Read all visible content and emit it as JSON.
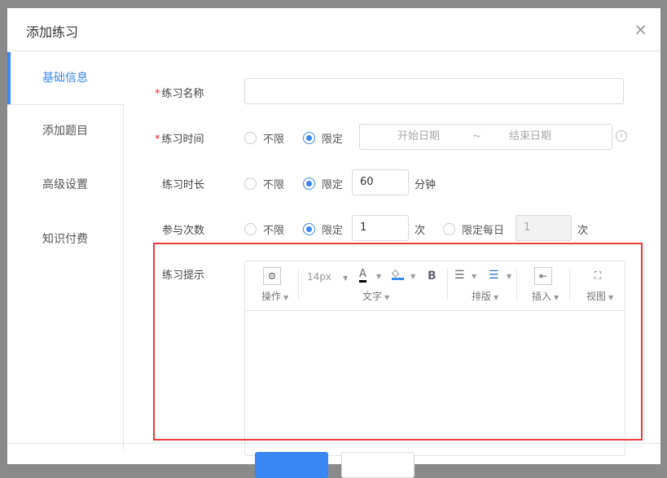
{
  "dialog": {
    "title": "添加练习",
    "close_icon": "×"
  },
  "sidebar": {
    "items": [
      {
        "label": "基础信息"
      },
      {
        "label": "添加题目"
      },
      {
        "label": "高级设置"
      },
      {
        "label": "知识付费"
      }
    ]
  },
  "form": {
    "name": {
      "label": "练习名称",
      "required": "*",
      "value": ""
    },
    "time": {
      "label": "练习时间",
      "required": "*",
      "opt_unlimited": "不限",
      "opt_limited": "限定",
      "start_placeholder": "开始日期",
      "separator": "~",
      "end_placeholder": "结束日期"
    },
    "duration": {
      "label": "练习时长",
      "opt_unlimited": "不限",
      "opt_limited": "限定",
      "value": "60",
      "unit": "分钟"
    },
    "attempts": {
      "label": "参与次数",
      "opt_unlimited": "不限",
      "opt_limited": "限定",
      "value": "1",
      "unit": "次",
      "opt_daily": "限定每日",
      "daily_value": "1",
      "daily_unit": "次"
    },
    "hint": {
      "label": "练习提示"
    }
  },
  "editor": {
    "font_size": "14px",
    "groups": {
      "operate": "操作",
      "text": "文字",
      "layout": "排版",
      "insert": "插入",
      "view": "视图"
    },
    "bold": "B",
    "font_color": "A"
  },
  "colors": {
    "accent": "#3a86f2",
    "highlight_border": "#f03a3a"
  }
}
